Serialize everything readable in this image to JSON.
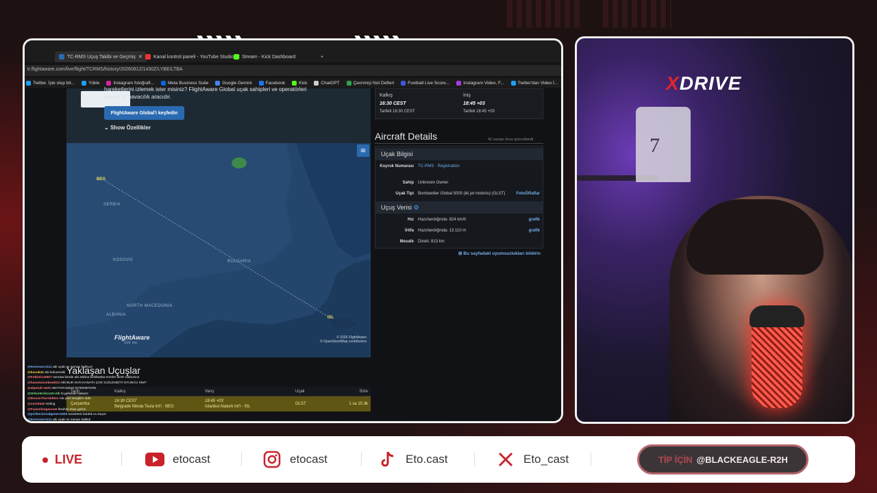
{
  "browser": {
    "tabs": [
      {
        "label": "TC-RMS Uçuş Takibi ve Geçmiş",
        "color": "#2a6ab0"
      },
      {
        "label": "Kanal kontrol paneli - YouTube Studio",
        "color": "#e33"
      },
      {
        "label": "Stream - Kick Dashboard",
        "color": "#53fc18"
      }
    ],
    "url": "tr.flightaware.com/live/flight/TCRMS/history/20260812/1430Z/LYBE/LTBA",
    "bookmarks": [
      "Twitter. İşte olup bit...",
      "Yükle",
      "Instagram fotoğrafl...",
      "Meta Business Suite",
      "Google Gemini",
      "Facebook",
      "Kick",
      "ChatGPT",
      "Çevrimiçi Not Defteri",
      "Football Live Score...",
      "Instagram Video, F...",
      "Twitter'dan Video İ..."
    ]
  },
  "promo": {
    "text1": "hareketlerini izlemek ister misiniz? FlightAware Global uçak sahipleri ve operatörleri",
    "text2": "için en iyi havacılık aracıdır.",
    "button": "FlightAware Global'i keşfedin",
    "show_features": "Show Özellikler"
  },
  "map": {
    "labels": {
      "serbia": "SERBIA",
      "kosovo": "KOSOVO",
      "bulgaria": "BULGARIA",
      "north_macedonia": "NORTH MACEDONIA",
      "albania": "ALBANIA"
    },
    "origin": "BEG",
    "dest": "ISL",
    "copyright": "© 2026 FlightAware",
    "osm": "© OpenStreetMap contributors",
    "logo": "FlightAware",
    "scale": "100 km"
  },
  "departure": {
    "dep_label": "Kalkış",
    "dep_time": "16:30 CEST",
    "dep_sched": "Tarifeli 16:30 CEST",
    "arr_label": "İniş",
    "arr_time": "18:45 +03",
    "arr_sched": "Tarifeli 18:45 +03"
  },
  "aircraft": {
    "title": "Aircraft Details",
    "updated": "42 saniye önce güncellendi",
    "info_title": "Uçak Bilgisi",
    "tail_key": "Kuyruk Numarası",
    "tail_val": "TC-RMS · Registration",
    "owner_key": "Sahip",
    "owner_val": "Unknown Owner",
    "type_key": "Uçak Tipi",
    "type_val": "Bombardier Global 5000 (iki jet motorlu) (GLST)",
    "type_link": "FotoĞRaflar",
    "flight_title": "Uçuş Verisi",
    "speed_key": "Hız",
    "speed_val": "Hazırlandığında: 824 km/h",
    "alt_key": "İrtifa",
    "alt_val": "Hazırlandığında: 13.110 m",
    "dist_key": "Mesafe",
    "dist_val": "Direkt: 813 km",
    "graph": "grafik",
    "report": "Bu sayfadaki uyumsuzlukları bildirin"
  },
  "upcoming": {
    "title": "Yaklaşan Uçuşlar",
    "headers": [
      "Tarih",
      "Kalkış",
      "Varış",
      "Uçak",
      "Süre"
    ],
    "row": {
      "date": "Çarşamba",
      "dep_time": "16:30 CEST",
      "dep_place": "Belgrade Nikola Tesla Int'l - BEG",
      "arr_time": "18:45 +03",
      "arr_place": "Istanbul Ataturk Int'l - ISL",
      "aircraft": "GLST",
      "duration": "1 sa 15 dk"
    }
  },
  "chat": [
    {
      "user": "@Kerevanrs111",
      "color": "#7fb2ff",
      "msg": "abi uçak ne zaman kalkıyor"
    },
    {
      "user": "@kucuk42",
      "color": "#ffd54a",
      "msg": "abi kuluvenski"
    },
    {
      "user": "@Futbolcu0907",
      "color": "#ff7a7a",
      "msg": "numara kimde abi askina besiktasta emeler direk vilahovice"
    },
    {
      "user": "@hasanuzunkuw923",
      "color": "#ff7a7a",
      "msg": "ABİ BUR DAN KANATA ÇOK İLGİLENDİYİ OYUNCU KİM?"
    },
    {
      "user": "@alpendi-162h",
      "color": "#ff7a7a",
      "msg": "ABİ PARADESİ İSTERMİYDİN"
    },
    {
      "user": "@OrkunKokcu10-olb",
      "color": "#7fe07f",
      "msg": "bi gelsinde bakarız"
    },
    {
      "user": "@Bonus7bernblt5m",
      "color": "#ff7a7a",
      "msg": "Abi yeni sevgilim oldu"
    },
    {
      "user": "@user8440",
      "color": "#ff7a7a",
      "msg": "Hiding"
    },
    {
      "user": "@Fıyavelangauna5",
      "color": "#ff7a7a",
      "msg": "İbrahim Diaz gelsin"
    },
    {
      "user": "@professionalgamer4305",
      "color": "#7fb2ff",
      "msg": "tozahöret buldük nu beyer"
    },
    {
      "user": "@Kerevanrs111",
      "color": "#7fb2ff",
      "msg": "abi uçak ne zaman kalktık"
    },
    {
      "user": "@Hacer00.Gengi",
      "color": "#ffd54a",
      "msg": "Bançeloança"
    },
    {
      "user": "@Hülyalak-dn1qc",
      "color": "#7fe07f",
      "msg": "31"
    },
    {
      "user": "@37neriwere7",
      "color": "#7fb2ff",
      "msg": "abi henüke #5 kiide mikrok kalkabilemiş"
    },
    {
      "user": "@MUSAKALAS-v2y",
      "color": "#ff7a7a",
      "msg": "Tarafar çildirdi ugaan kaldırmasını istiyor"
    },
    {
      "user": "@Bariflive-W6X",
      "color": "#7fb2ff",
      "msg": "8. hafta fb-1. Bjk-8 Salah sezonu kapattı"
    }
  ],
  "cam": {
    "brand_x": "X",
    "brand_rest": "DRIVE",
    "jersey": "7"
  },
  "bottom": {
    "live": "LIVE",
    "youtube": "etocast",
    "instagram": "etocast",
    "tiktok": "Eto.cast",
    "x": "Eto_cast",
    "tip_label": "TİP İÇİN",
    "tip_user": "@BLACKEAGLE-R2H"
  }
}
